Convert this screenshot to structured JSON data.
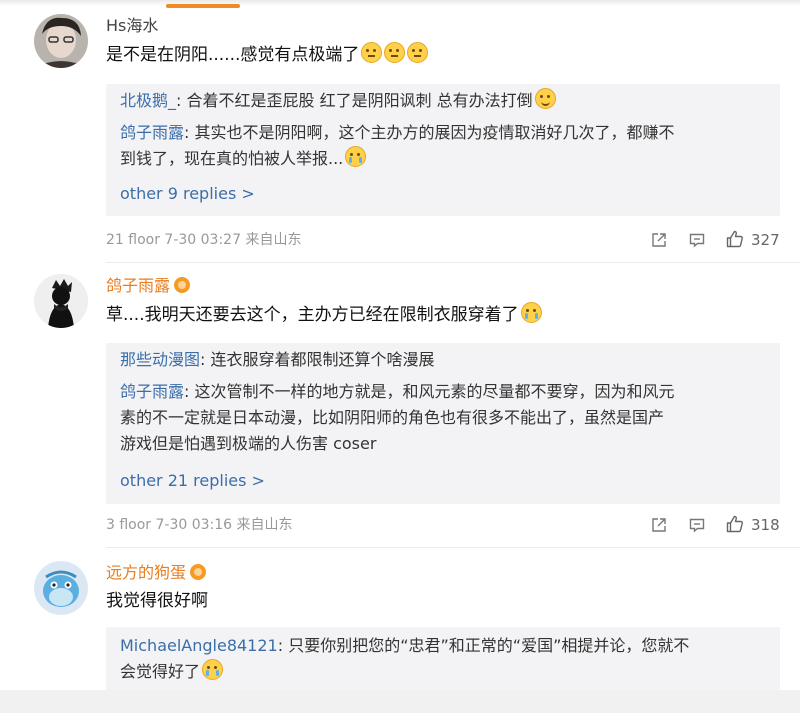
{
  "comments": [
    {
      "username": "Hs海水",
      "text": "是不是在阴阳......感觉有点极端了",
      "replies": [
        {
          "user": "北极鹅_",
          "text": ": 合着不红是歪屁股 红了是阴阳讽刺 总有办法打倒"
        },
        {
          "user": "鸽子雨露",
          "line1": ": 其实也不是阴阳啊，这个主办方的展因为疫情取消好几次了，都赚不",
          "line2": "到钱了，现在真的怕被人举报..."
        }
      ],
      "more": "other 9 replies >",
      "meta": "21 floor 7-30 03:27 来自山东",
      "likes": "327"
    },
    {
      "username": "鸽子雨露",
      "text": "草....我明天还要去这个，主办方已经在限制衣服穿着了",
      "replies": [
        {
          "user": "那些动漫图",
          "text": ": 连衣服穿着都限制还算个啥漫展"
        },
        {
          "user": "鸽子雨露",
          "line1": ": 这次管制不一样的地方就是，和风元素的尽量都不要穿，因为和风元",
          "line2": "素的不一定就是日本动漫，比如阴阳师的角色也有很多不能出了，虽然是国产",
          "line3": "游戏但是怕遇到极端的人伤害 coser"
        }
      ],
      "more": "other 21 replies >",
      "meta": "3 floor 7-30 03:16 来自山东",
      "likes": "318"
    },
    {
      "username": "远方的狗蛋",
      "text": "我觉得很好啊",
      "replies": [
        {
          "user": "MichaelAngle84121",
          "line1": ": 只要你别把您的“忠君”和正常的“爱国”相提并论，您就不",
          "line2": "会觉得好了"
        }
      ]
    }
  ],
  "icons": {
    "share": "share-icon",
    "comment": "comment-icon",
    "like": "thumbs-up-icon",
    "vip": "vip-badge-icon"
  },
  "colors": {
    "link_blue": "#3b6ea9",
    "vip_orange": "#ea7d1e",
    "reply_bg": "#f3f3f5",
    "meta_gray": "#999999"
  }
}
